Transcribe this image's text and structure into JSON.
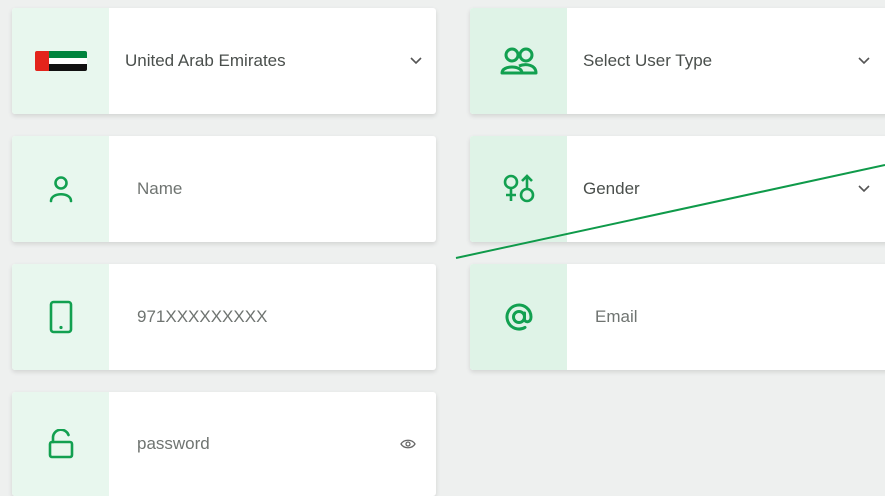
{
  "form": {
    "country": {
      "value": "United Arab Emirates",
      "icon": "uae-flag-icon"
    },
    "user_type": {
      "placeholder": "Select User Type",
      "icon": "users-icon"
    },
    "name": {
      "placeholder": "Name",
      "icon": "user-icon"
    },
    "gender": {
      "placeholder": "Gender",
      "icon": "gender-icon"
    },
    "phone": {
      "placeholder": "971XXXXXXXXX",
      "icon": "mobile-phone-icon"
    },
    "email": {
      "placeholder": "Email",
      "icon": "at-sign-icon"
    },
    "password": {
      "placeholder": "password",
      "icon": "unlock-icon"
    }
  },
  "colors": {
    "accent": "#12a050",
    "icon_bg": "#e8f7ee",
    "annotation_line": "#0f9a4a"
  }
}
